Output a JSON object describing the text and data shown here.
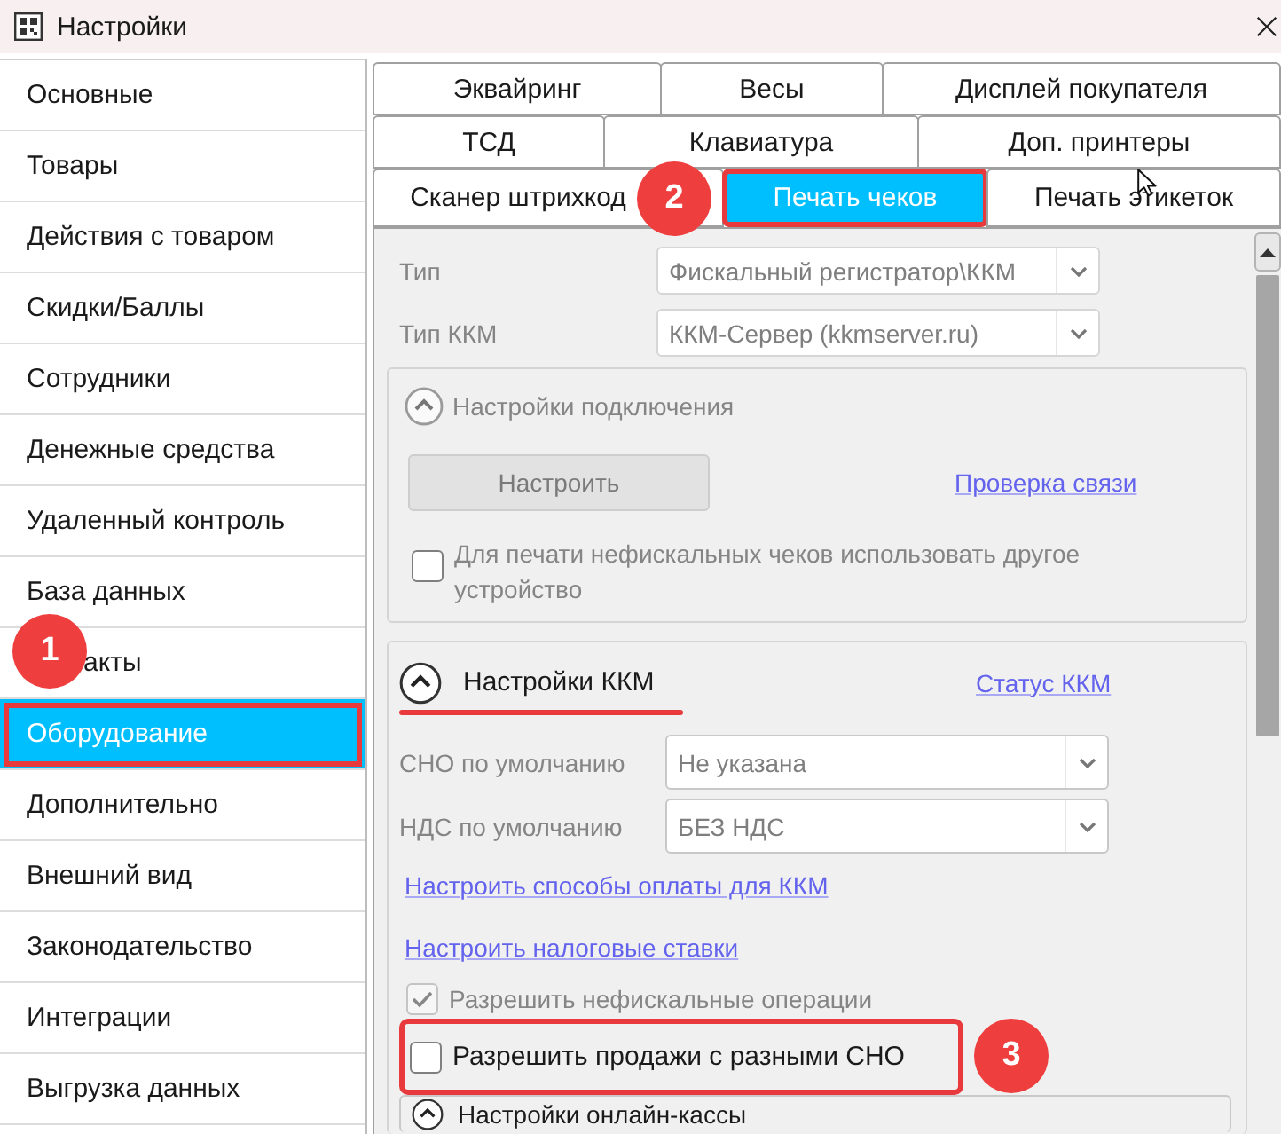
{
  "window": {
    "title": "Настройки"
  },
  "sidebar": {
    "items": [
      {
        "label": "Основные",
        "selected": false,
        "highlighted": false
      },
      {
        "label": "Товары",
        "selected": false,
        "highlighted": false
      },
      {
        "label": "Действия с товаром",
        "selected": false,
        "highlighted": false
      },
      {
        "label": "Скидки/Баллы",
        "selected": false,
        "highlighted": false
      },
      {
        "label": "Сотрудники",
        "selected": false,
        "highlighted": false
      },
      {
        "label": "Денежные средства",
        "selected": false,
        "highlighted": false
      },
      {
        "label": "Удаленный контроль",
        "selected": false,
        "highlighted": false
      },
      {
        "label": "База данных",
        "selected": false,
        "highlighted": false
      },
      {
        "label": "акты",
        "selected": false,
        "highlighted": false,
        "marker": "1"
      },
      {
        "label": "Оборудование",
        "selected": true,
        "highlighted": true
      },
      {
        "label": "Дополнительно",
        "selected": false,
        "highlighted": false
      },
      {
        "label": "Внешний вид",
        "selected": false,
        "highlighted": false
      },
      {
        "label": "Законодательство",
        "selected": false,
        "highlighted": false
      },
      {
        "label": "Интеграции",
        "selected": false,
        "highlighted": false
      },
      {
        "label": "Выгрузка данных",
        "selected": false,
        "highlighted": false
      }
    ]
  },
  "tab_rows": [
    {
      "tabs": [
        {
          "label": "Эквайринг",
          "selected": false,
          "highlighted": false
        },
        {
          "label": "Весы",
          "selected": false,
          "highlighted": false
        },
        {
          "label": "Дисплей покупателя",
          "selected": false,
          "highlighted": false
        }
      ]
    },
    {
      "tabs": [
        {
          "label": "ТСД",
          "selected": false,
          "highlighted": false
        },
        {
          "label": "Клавиатура",
          "selected": false,
          "highlighted": false
        },
        {
          "label": "Доп. принтеры",
          "selected": false,
          "highlighted": false
        }
      ]
    },
    {
      "tabs": [
        {
          "label": "Сканер штрихкод",
          "selected": false,
          "highlighted": false
        },
        {
          "label": "Печать чеков",
          "selected": true,
          "highlighted": true,
          "marker": "2"
        },
        {
          "label": "Печать этикеток",
          "selected": false,
          "highlighted": false
        }
      ]
    }
  ],
  "receipt_print": {
    "fields": [
      {
        "label": "Тип",
        "value": "Фискальный регистратор\\ККМ"
      },
      {
        "label": "Тип ККМ",
        "value": "ККМ-Сервер (kkmserver.ru)"
      }
    ],
    "connection_group": {
      "title": "Настройки подключения",
      "expanded": true,
      "button": "Настроить",
      "link": "Проверка связи",
      "checkboxes": [
        {
          "label": "Для печати нефискальных чеков использовать другое устройство",
          "checked": false,
          "highlighted": false
        }
      ]
    },
    "kkm_group": {
      "title": "Настройки ККМ",
      "expanded": true,
      "highlighted": true,
      "link": "Статус ККМ",
      "fields": [
        {
          "label": "СНО по умолчанию",
          "value": "Не указана"
        },
        {
          "label": "НДС по умолчанию",
          "value": "БЕЗ НДС"
        }
      ],
      "links": [
        "Настроить способы оплаты для ККМ",
        "Настроить налоговые ставки"
      ],
      "checkboxes": [
        {
          "label": "Разрешить нефискальные операции",
          "checked": true,
          "highlighted": false
        },
        {
          "label": "Разрешить продажи с разными СНО",
          "checked": false,
          "highlighted": true,
          "marker": "3"
        }
      ]
    },
    "online_group": {
      "title": "Настройки онлайн-кассы",
      "expanded": true
    }
  }
}
